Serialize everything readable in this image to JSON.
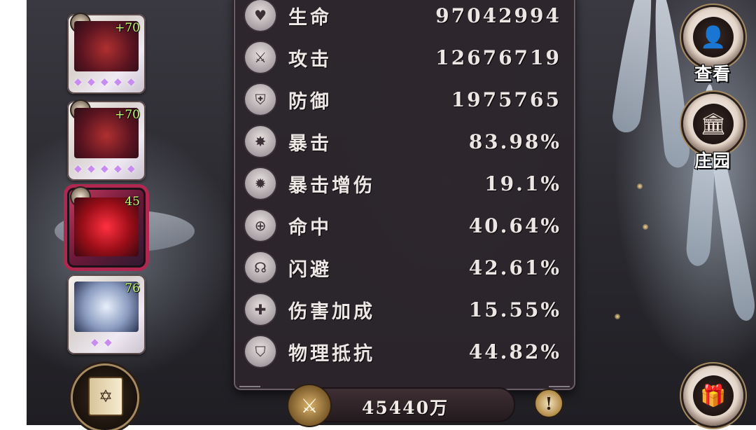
{
  "stats": [
    {
      "label": "生命",
      "value": "97042994",
      "icon": "heart-icon",
      "glyph": "♥"
    },
    {
      "label": "攻击",
      "value": "12676719",
      "icon": "sword-icon",
      "glyph": "⚔"
    },
    {
      "label": "防御",
      "value": "1975765",
      "icon": "shield-icon",
      "glyph": "⛨"
    },
    {
      "label": "暴击",
      "value": "83.98%",
      "icon": "claw-icon",
      "glyph": "✸"
    },
    {
      "label": "暴击增伤",
      "value": "19.1%",
      "icon": "crit-damage-icon",
      "glyph": "✹"
    },
    {
      "label": "命中",
      "value": "40.64%",
      "icon": "crosshair-icon",
      "glyph": "⊕"
    },
    {
      "label": "闪避",
      "value": "42.61%",
      "icon": "dodge-icon",
      "glyph": "☊"
    },
    {
      "label": "伤害加成",
      "value": "15.55%",
      "icon": "damage-bonus-icon",
      "glyph": "✚"
    },
    {
      "label": "物理抵抗",
      "value": "44.82%",
      "icon": "armor-icon",
      "glyph": "⛉"
    }
  ],
  "power": {
    "value": "45440万",
    "icon": "crossed-swords-icon"
  },
  "items": [
    {
      "level": "+70",
      "gems": [
        "◆",
        "◆",
        "◆",
        "◆",
        "◆"
      ],
      "type": "boots"
    },
    {
      "level": "+70",
      "gems": [
        "◆",
        "◆",
        "◆",
        "◆",
        "◆"
      ],
      "type": "armor"
    },
    {
      "level": "45",
      "gems": [],
      "type": "crystal"
    },
    {
      "level": "76",
      "gems": [
        "◆",
        "◆"
      ],
      "type": "angel"
    }
  ],
  "buttons": {
    "view_label": "查看",
    "manor_label": "庄园"
  },
  "colors": {
    "panel_bg": "#2c262c",
    "stat_text": "#ece7e4",
    "level_text": "#c6ff6b"
  }
}
